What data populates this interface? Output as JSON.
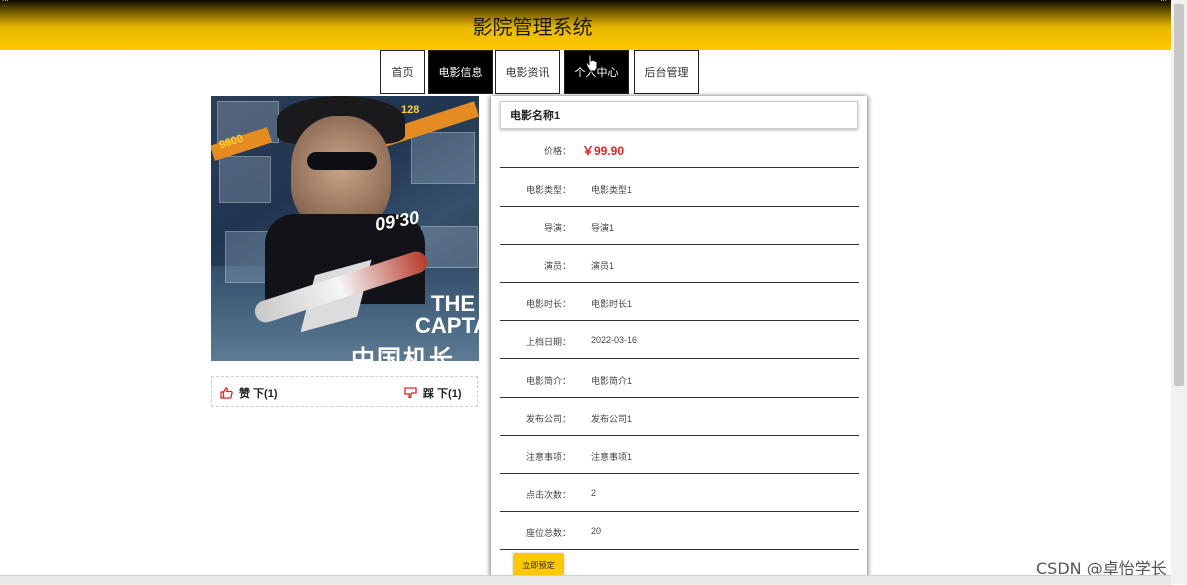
{
  "header": {
    "title": "影院管理系统",
    "top_left_fragment": "...",
    "top_right_fragment": "..."
  },
  "nav": {
    "items": [
      {
        "label": "首页",
        "active": false
      },
      {
        "label": "电影信息",
        "active": true
      },
      {
        "label": "电影资讯",
        "active": false
      },
      {
        "label": "个人中心",
        "active": true
      },
      {
        "label": "后台管理",
        "active": false
      }
    ]
  },
  "poster": {
    "title_en": "THE CAPTAIN",
    "title_cn": "中国机长",
    "time_text": "09'30",
    "gold_text_1": "9800",
    "gold_text_2": "128"
  },
  "votes": {
    "like_label": "赞  下(1)",
    "dislike_label": "踩  下(1)",
    "like_icon": "thumbs-up-icon",
    "dislike_icon": "thumbs-down-icon",
    "icon_color": "#e02424"
  },
  "movie": {
    "name": "电影名称1",
    "rows": [
      {
        "key": "价格：",
        "value": "￥99.90"
      },
      {
        "key": "电影类型：",
        "value": "电影类型1"
      },
      {
        "key": "导演：",
        "value": "导演1"
      },
      {
        "key": "演员：",
        "value": "演员1"
      },
      {
        "key": "电影时长：",
        "value": "电影时长1"
      },
      {
        "key": "上档日期：",
        "value": "2022-03-16"
      },
      {
        "key": "电影简介：",
        "value": "电影简介1"
      },
      {
        "key": "发布公司：",
        "value": "发布公司1"
      },
      {
        "key": "注意事项：",
        "value": "注意事项1"
      },
      {
        "key": "点击次数：",
        "value": "2"
      },
      {
        "key": "座位总数：",
        "value": "20"
      }
    ],
    "book_button": "立即预定"
  },
  "watermark": "CSDN @卓怡学长",
  "colors": {
    "accent": "#ffc800",
    "price": "#e02424"
  }
}
